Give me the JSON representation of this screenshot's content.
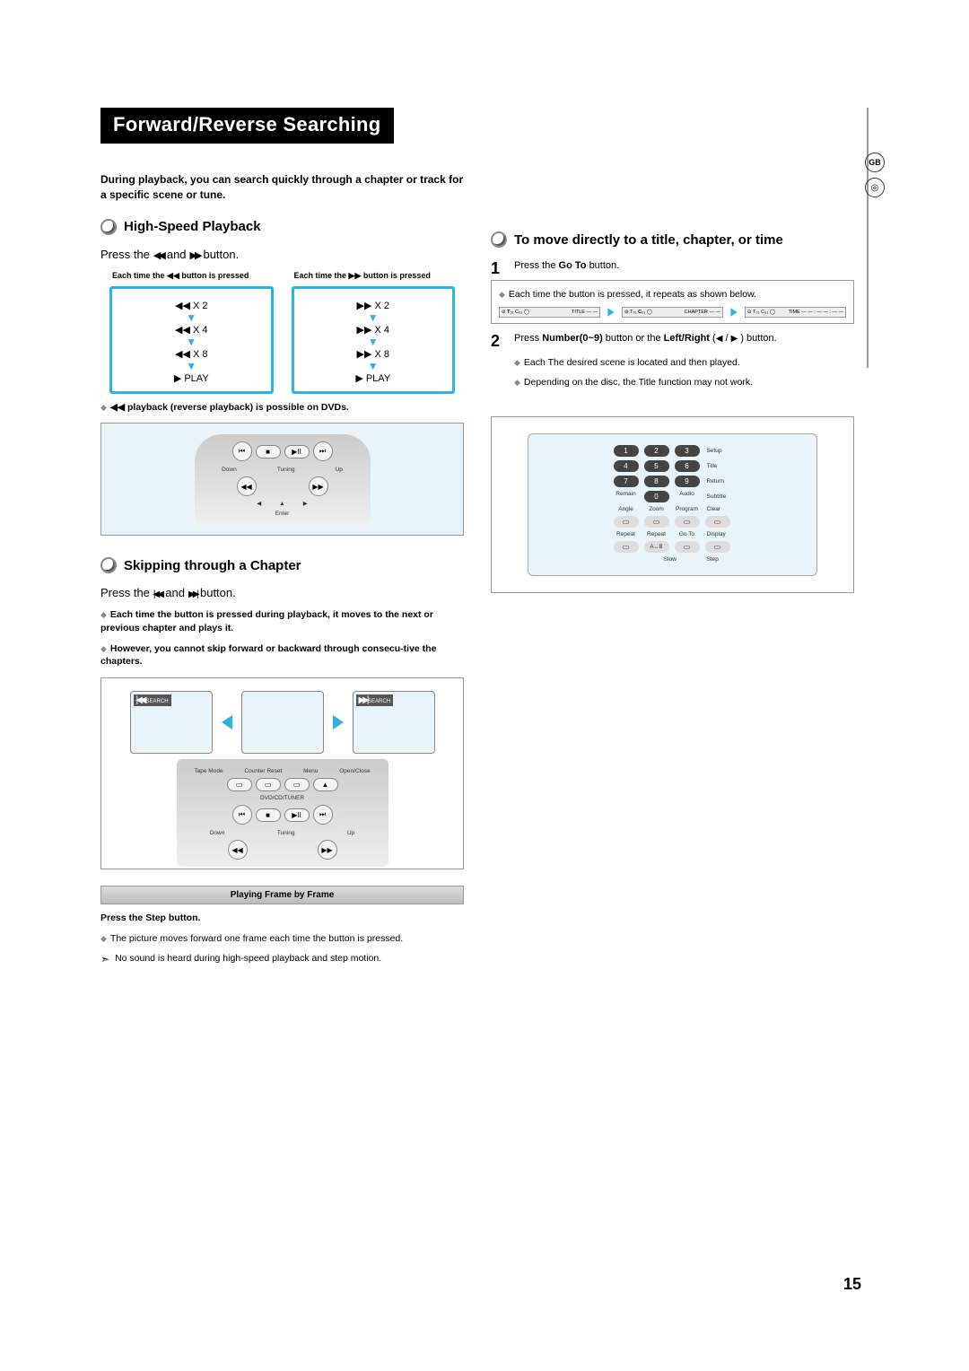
{
  "page_number": "15",
  "side_badge": "GB",
  "title": "Forward/Reverse Searching",
  "intro": "During playback, you can search quickly through a chapter or track for a specific scene or tune.",
  "sections": {
    "highspeed": {
      "title": "High-Speed Playback",
      "press_prefix": "Press the",
      "press_mid": "and",
      "press_suffix": "button.",
      "col_left_head": "Each time the ◀◀ button is pressed",
      "col_right_head": "Each time the ▶▶ button is pressed",
      "speeds_left": [
        "◀◀  X 2",
        "◀◀  X 4",
        "◀◀  X 8",
        "▶  PLAY"
      ],
      "speeds_right": [
        "▶▶  X 2",
        "▶▶  X 4",
        "▶▶  X 8",
        "▶  PLAY"
      ],
      "note": "◀◀ playback (reverse playback) is possible on DVDs.",
      "remote_labels": {
        "down": "Down",
        "tuning": "Tuning",
        "up": "Up",
        "enter": "Enter"
      }
    },
    "skipping": {
      "title": "Skipping through a Chapter",
      "press_prefix": "Press the",
      "press_mid": "and",
      "press_suffix": "button.",
      "notes": [
        "Each time the button is pressed during playback, it moves to the next or previous chapter and plays it.",
        "However, you cannot skip forward or backward through consecu-tive the chapters."
      ],
      "search_label": "SEARCH",
      "top_btn_labels": [
        "Tape Mode",
        "Counter Reset",
        "Menu",
        "Open/Close"
      ],
      "dvd_label": "DVD/CD/TUNER",
      "remote_labels": {
        "down": "Down",
        "tuning": "Tuning",
        "up": "Up"
      }
    },
    "frame": {
      "bar": "Playing Frame by Frame",
      "instruction": "Press the Step button.",
      "note1": "The picture moves forward one frame each time the button is pressed.",
      "note2": "No sound is heard during high-speed playback and step motion."
    },
    "goto": {
      "title": "To move directly to a title, chapter, or time",
      "step1_prefix": "Press the",
      "step1_bold": "Go To",
      "step1_suffix": "button.",
      "step1_note": "Each time the button is pressed, it repeats as shown below.",
      "bars": {
        "title": "TITLE  —  —",
        "chapter": "CHAPTER  —  —",
        "time": "TIME — — : — — : — —"
      },
      "step2_parts": {
        "p1": "Press ",
        "b1": "Number(0~9)",
        "p2": " button or the ",
        "b2": "Left/Right",
        "p3": " (",
        "p4": " / ",
        "p5": " ) button."
      },
      "step2_notes": [
        "Each The desired scene is located and then played.",
        "Depending on the disc, the Title function may not work."
      ],
      "keypad": {
        "nums": [
          "1",
          "2",
          "3",
          "4",
          "5",
          "6",
          "7",
          "8",
          "9",
          "0"
        ],
        "side_labels": [
          "Setup",
          "Title",
          "Return",
          "Subtitle",
          "Clear",
          "Display",
          "Step"
        ],
        "row_labels_a": [
          "Remain",
          "",
          "Audio"
        ],
        "row_labels_b": [
          "Angle",
          "Zoom",
          "Program"
        ],
        "row_labels_c": [
          "Repeat",
          "Repeat",
          "Go To"
        ],
        "ab": "A↔B",
        "slow": "Slow"
      }
    }
  }
}
